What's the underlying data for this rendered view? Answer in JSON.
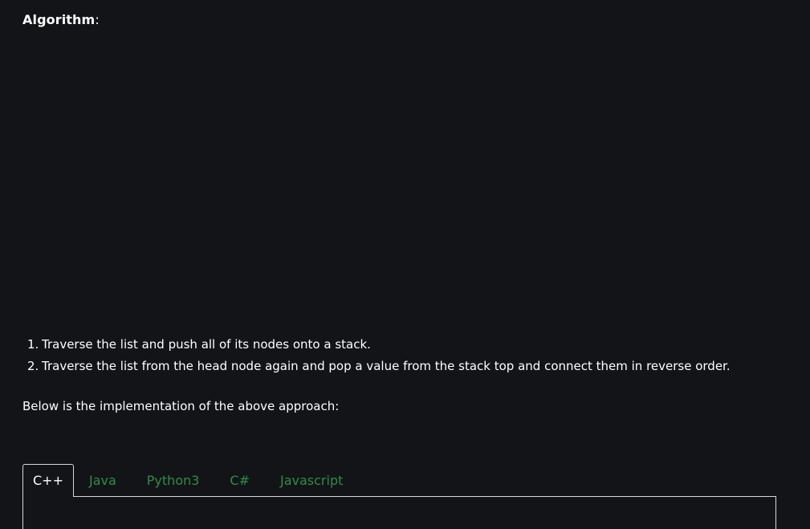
{
  "heading": {
    "label": "Algorithm",
    "suffix": ":"
  },
  "steps": [
    {
      "num": "1.",
      "text": "Traverse the list and push all of its nodes onto a stack."
    },
    {
      "num": "2.",
      "text": "Traverse the list from the head node again and pop a value from the stack top and connect them in reverse order."
    }
  ],
  "intro": "Below is the implementation of the above approach:",
  "tabs": [
    {
      "label": "C++",
      "active": true
    },
    {
      "label": "Java",
      "active": false
    },
    {
      "label": "Python3",
      "active": false
    },
    {
      "label": "C#",
      "active": false
    },
    {
      "label": "Javascript",
      "active": false
    }
  ],
  "colors": {
    "background": "#131417",
    "text": "#ffffff",
    "tab_inactive": "#2f8d46",
    "tab_border": "#d8d8d8"
  }
}
